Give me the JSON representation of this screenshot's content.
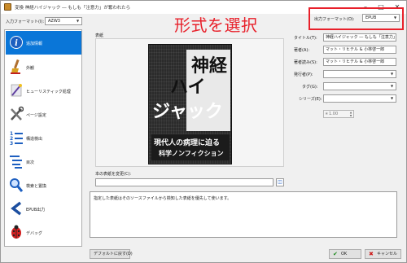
{
  "window": {
    "title": "変換 神経ハイジャック ― もしも「注意力」が奪われたら"
  },
  "input_format": {
    "label": "入力フォーマット(I):",
    "value": "AZW3"
  },
  "output_format": {
    "label": "出力フォーマット(O):",
    "value": "EPUB"
  },
  "annotation": {
    "text": "形式を選択"
  },
  "sidebar": {
    "items": [
      {
        "label": "追加情報",
        "icon": "info-icon"
      },
      {
        "label": "外観",
        "icon": "paintbrush-icon"
      },
      {
        "label": "ヒューリスティック処理",
        "icon": "magic-wand-icon"
      },
      {
        "label": "ページ設定",
        "icon": "tools-icon"
      },
      {
        "label": "構造検出",
        "icon": "numbered-list-icon"
      },
      {
        "label": "目次",
        "icon": "toc-icon"
      },
      {
        "label": "検索と置換",
        "icon": "magnifier-icon"
      },
      {
        "label": "EPUB出力",
        "icon": "back-arrow-icon"
      },
      {
        "label": "デバッグ",
        "icon": "ladybug-icon"
      }
    ]
  },
  "cover": {
    "label": "表紙",
    "change_label": "本の表紙を変更(C):",
    "path_value": "",
    "book": {
      "title_line1": "神経",
      "title_line2": "ハイ",
      "title_line3": "ジャック",
      "subtitle1": "現代人の病理に迫る",
      "subtitle2": "科学ノンフィクション"
    }
  },
  "metadata": {
    "title_label": "タイトル(T):",
    "title_value": "神経ハイジャック ― もしも「注意力」が奪われたら",
    "author_label": "著者(A):",
    "author_value": "マット・リヒテル & 小林啓一郎",
    "author_sort_label": "著者読み(S):",
    "author_sort_value": "マット・リヒテル & 小林啓一郎",
    "publisher_label": "発行者(P):",
    "tags_label": "タグ(G):",
    "series_label": "シリーズ(E):",
    "rating_value": "1.00"
  },
  "description": {
    "text": "指定した表紙はそのソースファイルから検知した表紙を優先して使います。"
  },
  "buttons": {
    "defaults": "デフォルトに戻す(D)",
    "ok": "OK",
    "cancel": "キャンセル"
  },
  "colors": {
    "accent": "#0a76d8",
    "annotation": "#e8202a"
  }
}
